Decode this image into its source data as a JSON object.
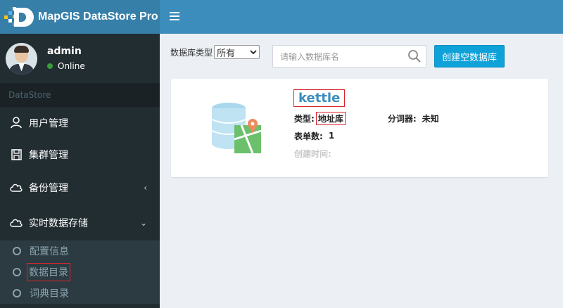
{
  "app": {
    "title": "MapGIS DataStore Pro"
  },
  "user": {
    "name": "admin",
    "status": "Online"
  },
  "sidebar": {
    "header": "DataStore",
    "items": [
      {
        "label": "用户管理",
        "icon": "user-icon"
      },
      {
        "label": "集群管理",
        "icon": "save-icon"
      },
      {
        "label": "备份管理",
        "icon": "cloud-icon",
        "chevron": "‹"
      },
      {
        "label": "实时数据存储",
        "icon": "cloud-icon",
        "chevron": "⌄"
      }
    ],
    "subitems": [
      {
        "label": "配置信息"
      },
      {
        "label": "数据目录"
      },
      {
        "label": "词典目录"
      }
    ]
  },
  "toolbar": {
    "type_label": "数据库类型",
    "type_selected": "所有",
    "search_placeholder": "请输入数据库名",
    "create_button": "创建空数据库"
  },
  "database": {
    "name": "kettle",
    "type_label": "类型:",
    "type_value": "地址库",
    "tokenizer_label": "分词器:",
    "tokenizer_value": "未知",
    "tables_label": "表单数:",
    "tables_value": "1",
    "created_label": "创建时间:"
  },
  "colors": {
    "topbar": "#3c8dbc",
    "sidebar": "#222d32",
    "accent_button": "#0fa2d8",
    "highlight_border": "#d9262b"
  }
}
